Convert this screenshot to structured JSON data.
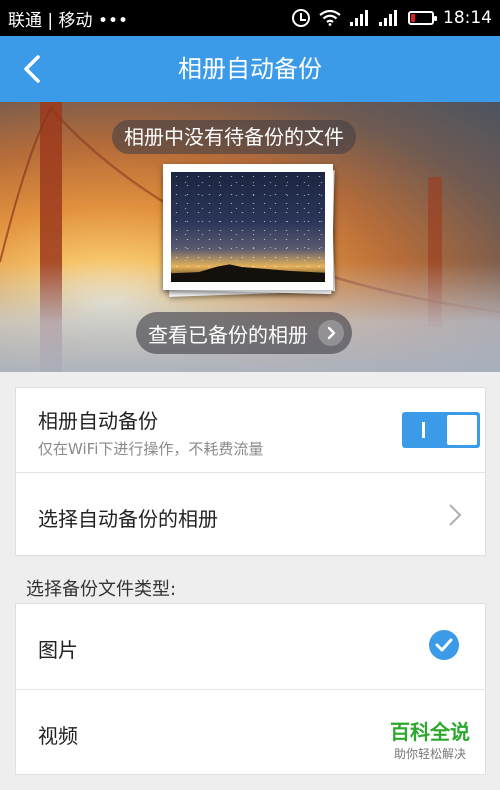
{
  "status_bar": {
    "carrier": "联通 | 移动 •••",
    "time": "18:14",
    "icons": [
      "alarm-icon",
      "wifi-icon",
      "signal-icon",
      "signal-icon",
      "battery-icon"
    ]
  },
  "header": {
    "title": "相册自动备份",
    "back_icon": "back-arrow-icon"
  },
  "banner": {
    "message": "相册中没有待备份的文件",
    "view_button_label": "查看已备份的相册"
  },
  "settings": {
    "auto_backup": {
      "label": "相册自动备份",
      "sub": "仅在WiFi下进行操作，不耗费流量",
      "enabled": true
    },
    "choose_album_label": "选择自动备份的相册"
  },
  "file_types": {
    "section_title": "选择备份文件类型:",
    "items": [
      {
        "label": "图片",
        "checked": true
      },
      {
        "label": "视频",
        "checked": false
      }
    ]
  },
  "watermark": {
    "title": "百科全说",
    "subtitle": "助你轻松解决"
  },
  "colors": {
    "accent": "#3c9be8",
    "watermark_green": "#2ca82c"
  }
}
